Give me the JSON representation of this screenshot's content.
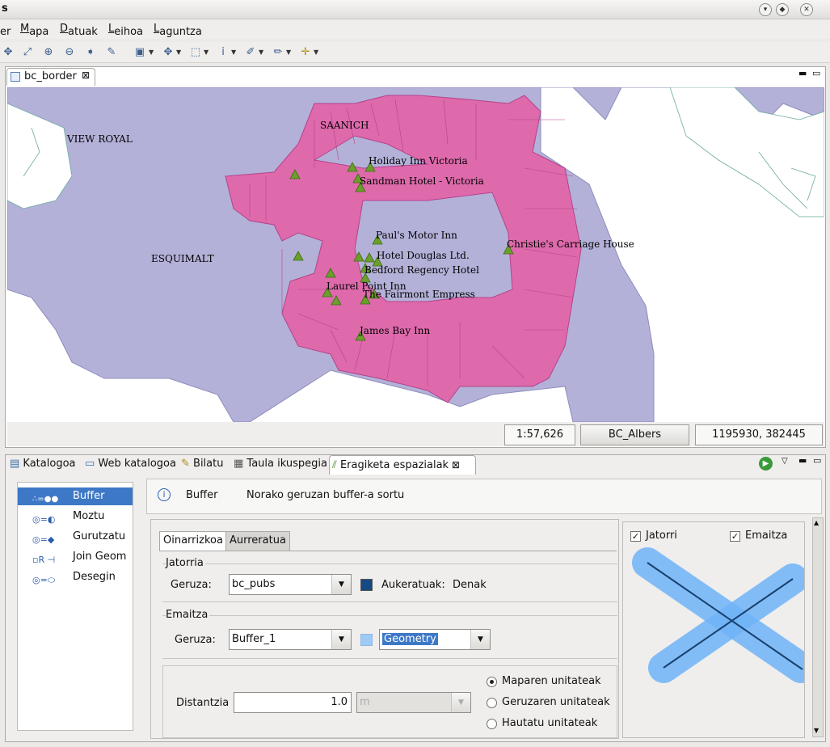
{
  "app": {
    "title_fragment": "s"
  },
  "menu": {
    "items": [
      {
        "pre": "",
        "ul": "",
        "rest": "er"
      },
      {
        "pre": "",
        "ul": "M",
        "rest": "apa"
      },
      {
        "pre": "",
        "ul": "D",
        "rest": "atuak"
      },
      {
        "pre": "",
        "ul": "L",
        "rest": "eihoa"
      },
      {
        "pre": "",
        "ul": "L",
        "rest": "aguntza"
      }
    ]
  },
  "map_editor": {
    "tab_label": "bc_border",
    "labels": {
      "view_royal": "VIEW ROYAL",
      "saanich": "SAANICH",
      "esquimalt": "ESQUIMALT",
      "holiday_inn": "Holiday Inn Victoria",
      "sandman": "Sandman Hotel - Victoria",
      "pauls": "Paul's Motor Inn",
      "christies": "Christie's Carriage House",
      "douglas": "Hotel Douglas Ltd.",
      "bedford": "Bedford Regency Hotel",
      "laurel": "Laurel Point Inn",
      "fairmont": "The Fairmont Empress",
      "james_bay": "James Bay Inn"
    },
    "status": {
      "scale": "1:57,626",
      "crs": "BC_Albers",
      "coords": "1195930, 382445"
    },
    "colors": {
      "land": "#b3b1d8",
      "city": "#de6aac",
      "water": "#ffffff",
      "poi": "#6aa02a"
    }
  },
  "bottom_tabs": [
    "Katalogoa",
    "Web katalogoa",
    "Bilatu",
    "Taula ikuspegia",
    "Eragiketa espazialak"
  ],
  "operations": [
    "Buffer",
    "Moztu",
    "Gurutzatu",
    "Join Geom",
    "Desegin"
  ],
  "header": {
    "op_name": "Buffer",
    "description": "Norako geruzan buffer-a sortu"
  },
  "form": {
    "tabs": [
      "Oinarrizkoa",
      "Aurreratua"
    ],
    "source_group": "Jatorria",
    "layer_label": "Geruza:",
    "source_layer": "bc_pubs",
    "selected_label": "Aukeratuak:",
    "selected_value": "Denak",
    "result_group": "Emaitza",
    "result_layer_label": "Geruza:",
    "result_layer": "Buffer_1",
    "geometry_value": "Geometry",
    "distance_label": "Distantzia",
    "distance_value": "1.0",
    "unit_value": "m",
    "radio_options": [
      "Maparen unitateak",
      "Geruzaren unitateak",
      "Hautatu unitateak"
    ],
    "source_color": "#164a82",
    "result_color": "#9ecbf6"
  },
  "preview": {
    "source_check": "Jatorri",
    "result_check": "Emaitza"
  }
}
